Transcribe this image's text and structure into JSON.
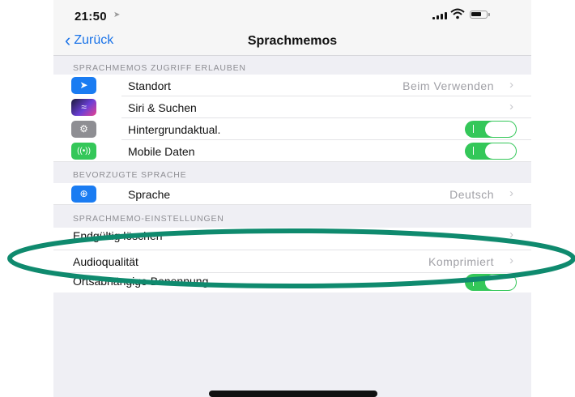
{
  "status": {
    "time": "21:50"
  },
  "nav": {
    "back_label": "Zurück",
    "title": "Sprachmemos"
  },
  "sections": {
    "access_header": "SPRACHMEMOS ZUGRIFF ERLAUBEN",
    "language_header": "BEVORZUGTE SPRACHE",
    "settings_header": "SPRACHMEMO-EINSTELLUNGEN"
  },
  "access": {
    "location": {
      "label": "Standort",
      "value": "Beim Verwenden"
    },
    "siri": {
      "label": "Siri & Suchen"
    },
    "background": {
      "label": "Hintergrundaktual.",
      "enabled": true
    },
    "mobile": {
      "label": "Mobile Daten",
      "enabled": true
    }
  },
  "language": {
    "label": "Sprache",
    "value": "Deutsch"
  },
  "settings": {
    "delete": {
      "label": "Endgültig löschen"
    },
    "quality": {
      "label": "Audioqualität",
      "value": "Komprimiert"
    },
    "location_naming": {
      "label": "Ortsabhängige Benennung",
      "enabled": true
    }
  },
  "colors": {
    "accent": "#1a73e8",
    "toggle_on": "#34c759",
    "highlight_ellipse": "#0f8a6e"
  },
  "icons": {
    "location": "location-arrow-icon",
    "siri": "siri-icon",
    "background": "gear-icon",
    "mobile": "antenna-icon",
    "language": "globe-icon"
  }
}
